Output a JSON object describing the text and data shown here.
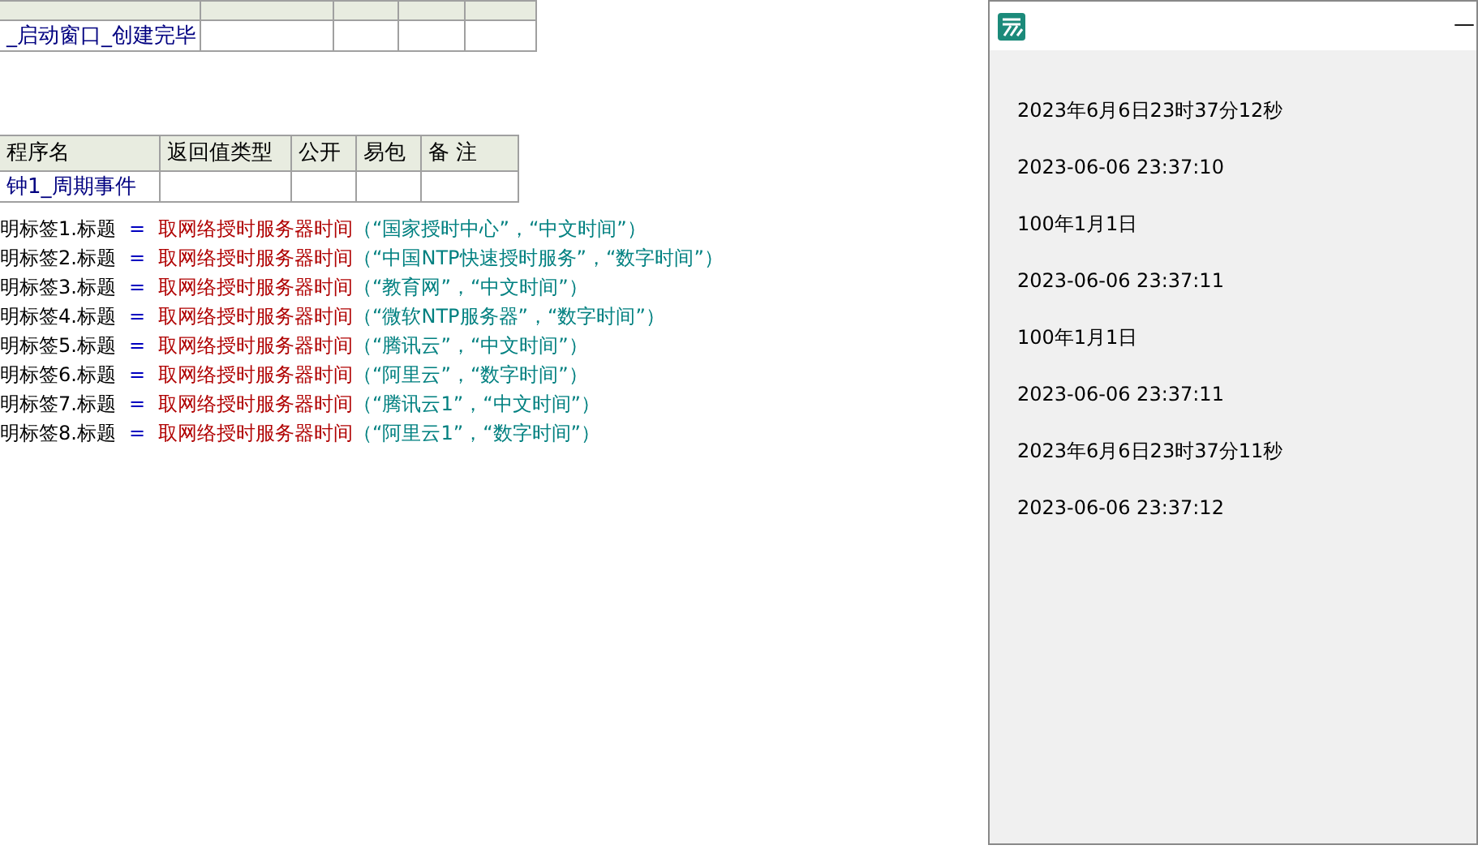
{
  "table_1": {
    "rows": [
      [
        "_启动窗口_创建完毕",
        "",
        "",
        "",
        ""
      ]
    ]
  },
  "table_2": {
    "columns": [
      "程序名",
      "返回值类型",
      "公开",
      "易包",
      "备 注"
    ],
    "rows": [
      [
        "钟1_周期事件",
        "",
        "",
        "",
        ""
      ]
    ]
  },
  "code_lines": [
    {
      "target": "明标签1.标题",
      "op": "=",
      "func": "取网络授时服务器时间",
      "args": "（“国家授时中心”，“中文时间”）"
    },
    {
      "target": "明标签2.标题",
      "op": "=",
      "func": "取网络授时服务器时间",
      "args": "（“中国NTP快速授时服务”，“数字时间”）"
    },
    {
      "target": "明标签3.标题",
      "op": "=",
      "func": "取网络授时服务器时间",
      "args": "（“教育网”，“中文时间”）"
    },
    {
      "target": "明标签4.标题",
      "op": "=",
      "func": "取网络授时服务器时间",
      "args": "（“微软NTP服务器”，“数字时间”）"
    },
    {
      "target": "明标签5.标题",
      "op": "=",
      "func": "取网络授时服务器时间",
      "args": "（“腾讯云”，“中文时间”）"
    },
    {
      "target": "明标签6.标题",
      "op": "=",
      "func": "取网络授时服务器时间",
      "args": "（“阿里云”，“数字时间”）"
    },
    {
      "target": "明标签7.标题",
      "op": "=",
      "func": "取网络授时服务器时间",
      "args": "（“腾讯云1”，“中文时间”）"
    },
    {
      "target": "明标签8.标题",
      "op": "=",
      "func": "取网络授时服务器时间",
      "args": "（“阿里云1”，“数字时间”）"
    }
  ],
  "window": {
    "minimize": "—",
    "labels": [
      "2023年6月6日23时37分12秒",
      "2023-06-06 23:37:10",
      "100年1月1日",
      "2023-06-06 23:37:11",
      "100年1月1日",
      "2023-06-06 23:37:11",
      "2023年6月6日23时37分11秒",
      "2023-06-06 23:37:12"
    ]
  }
}
